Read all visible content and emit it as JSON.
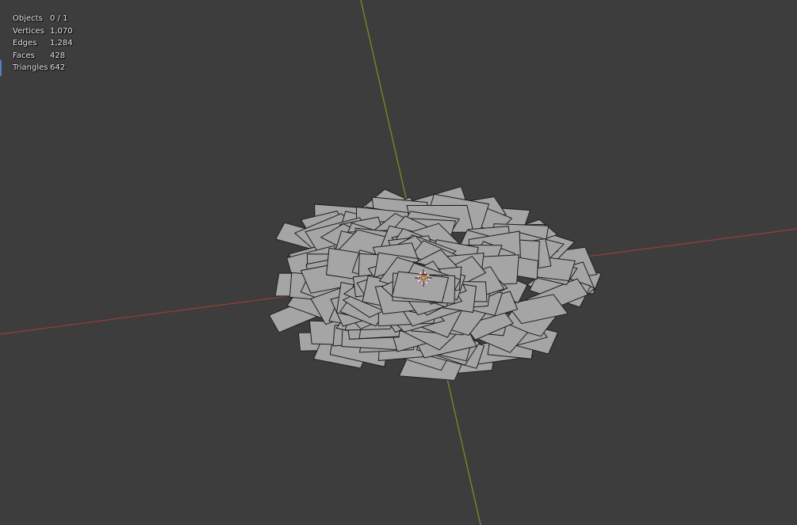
{
  "viewport": {
    "background": "#3d3d3d",
    "axis_x_color": "#9a3b3b",
    "axis_y_color": "#6b8e23",
    "face_color": "#a5a5a5",
    "edge_color": "#1e1e1e",
    "origin_icon": "3d-cursor-icon"
  },
  "stats": [
    {
      "label": "Objects",
      "value": "0 / 1"
    },
    {
      "label": "Vertices",
      "value": "1,070"
    },
    {
      "label": "Edges",
      "value": "1,284"
    },
    {
      "label": "Faces",
      "value": "428"
    },
    {
      "label": "Triangles",
      "value": "642"
    }
  ]
}
